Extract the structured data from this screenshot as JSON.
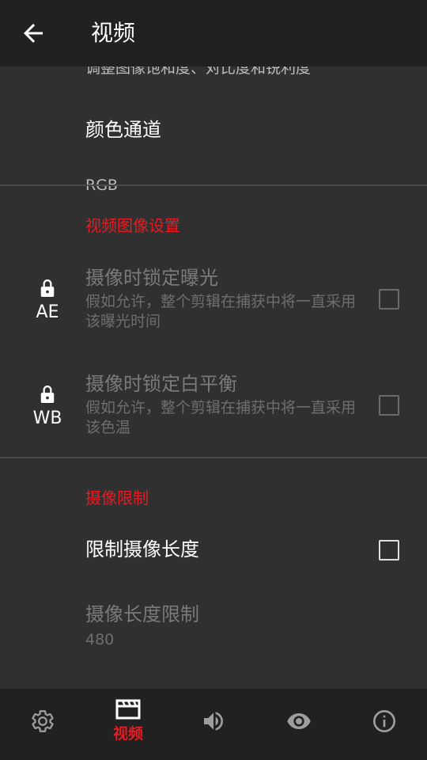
{
  "app_bar": {
    "title": "视频"
  },
  "clipped_summary": "调整图像饱和度、对比度和锐利度",
  "color_channel": {
    "title": "颜色通道",
    "value": "RGB"
  },
  "video_image_settings": {
    "header": "视频图像设置",
    "lock_exposure": {
      "badge": "AE",
      "title": "摄像时锁定曝光",
      "summary": "假如允许，整个剪辑在捕获中将一直采用该曝光时间",
      "checked": false,
      "enabled": false
    },
    "lock_white_balance": {
      "badge": "WB",
      "title": "摄像时锁定白平衡",
      "summary": "假如允许，整个剪辑在捕获中将一直采用该色温",
      "checked": false,
      "enabled": false
    }
  },
  "recording_limits": {
    "header": "摄像限制",
    "limit_length": {
      "title": "限制摄像长度",
      "checked": false
    },
    "length_limit": {
      "title": "摄像长度限制",
      "value": "480",
      "enabled": false
    }
  },
  "bottom_nav": {
    "active_label": "视频",
    "items": [
      "settings-icon",
      "video-icon",
      "volume-icon",
      "eye-icon",
      "info-icon"
    ]
  },
  "colors": {
    "accent": "#e51c23",
    "background": "#303030",
    "bar": "#212121"
  }
}
